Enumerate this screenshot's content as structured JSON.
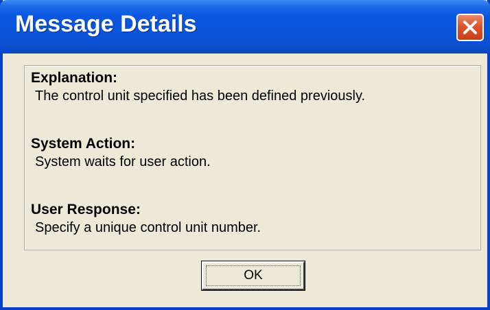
{
  "dialog": {
    "title": "Message Details",
    "close_icon": "close-x-icon",
    "sections": [
      {
        "heading": "Explanation:",
        "text": "The control unit specified has been defined previously."
      },
      {
        "heading": "System Action:",
        "text": "System waits for user action."
      },
      {
        "heading": "User Response:",
        "text": "Specify a unique control unit number."
      }
    ],
    "ok_label": "OK"
  },
  "colors": {
    "titlebar": "#0a54d8",
    "close_button": "#d9552f",
    "window_face": "#ece9d8"
  }
}
